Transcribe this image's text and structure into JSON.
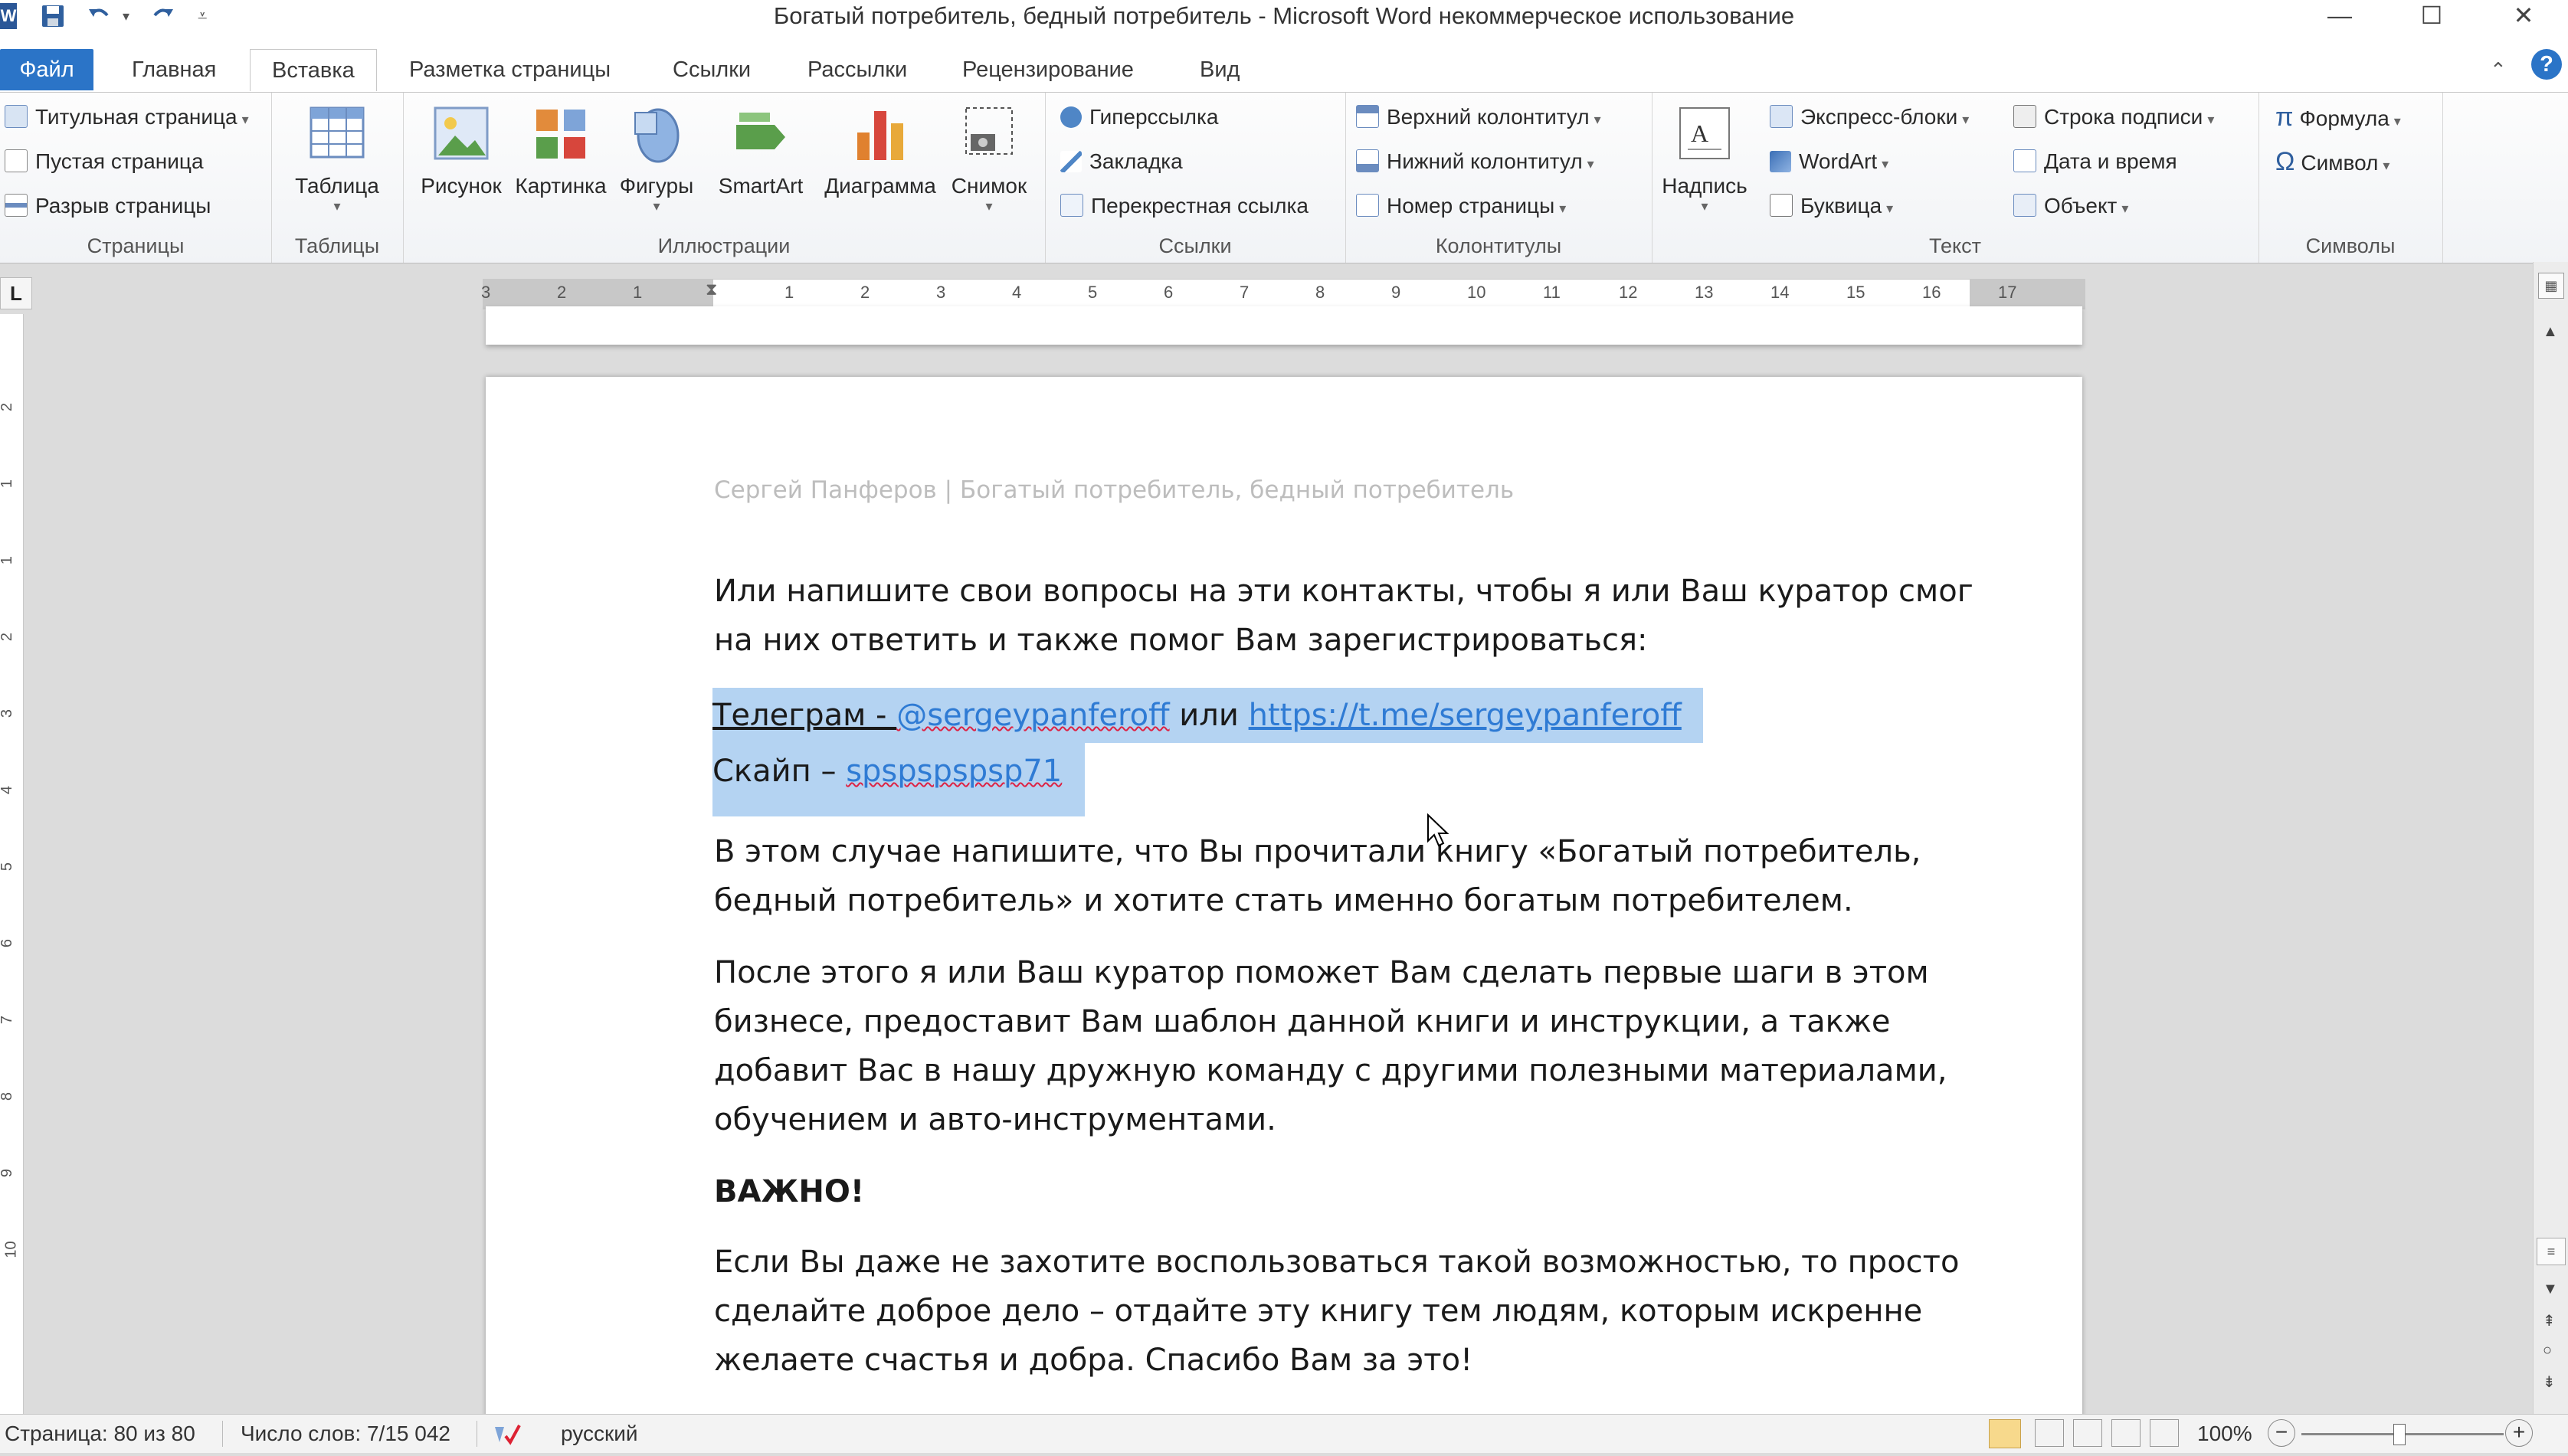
{
  "window": {
    "title": "Богатый потребитель, бедный потребитель  -  Microsoft Word некоммерческое использование",
    "minimize": "—",
    "maximize": "☐",
    "close": "✕"
  },
  "tabs": [
    "Файл",
    "Главная",
    "Вставка",
    "Разметка страницы",
    "Ссылки",
    "Рассылки",
    "Рецензирование",
    "Вид"
  ],
  "ribbon": {
    "pages": {
      "label": "Страницы",
      "items": [
        "Титульная страница",
        "Пустая страница",
        "Разрыв страницы"
      ]
    },
    "tables": {
      "label": "Таблицы",
      "table": "Таблица"
    },
    "illustrations": {
      "label": "Иллюстрации",
      "items": [
        "Рисунок",
        "Картинка",
        "Фигуры",
        "SmartArt",
        "Диаграмма",
        "Снимок"
      ]
    },
    "links": {
      "label": "Ссылки",
      "items": [
        "Гиперссылка",
        "Закладка",
        "Перекрестная ссылка"
      ]
    },
    "headers": {
      "label": "Колонтитулы",
      "items": [
        "Верхний колонтитул",
        "Нижний колонтитул",
        "Номер страницы"
      ]
    },
    "text": {
      "label": "Текст",
      "textbox": "Надпись",
      "items": [
        "Экспресс-блоки",
        "WordArt",
        "Буквица",
        "Строка подписи",
        "Дата и время",
        "Объект"
      ]
    },
    "symbols": {
      "label": "Символы",
      "items": [
        "Формула",
        "Символ"
      ]
    }
  },
  "ruler": {
    "h_left": [
      "3",
      "2",
      "1"
    ],
    "h_right": [
      "1",
      "2",
      "3",
      "4",
      "5",
      "6",
      "7",
      "8",
      "9",
      "10",
      "11",
      "12",
      "13",
      "14",
      "15",
      "16",
      "17"
    ],
    "v": [
      "2",
      "1",
      "1",
      "2",
      "3",
      "4",
      "5",
      "6",
      "7",
      "8",
      "9",
      "10"
    ]
  },
  "document": {
    "running_header": "Сергей Панферов | Богатый потребитель, бедный потребитель",
    "p1_line1": "Или напишите свои вопросы на эти контакты, чтобы я или Ваш куратор смог",
    "p1_line2": "на них ответить и также помог Вам зарегистрироваться:",
    "telegram_label": "Телеграм - ",
    "telegram_handle": "@sergeypanferoff",
    "telegram_or": " или ",
    "telegram_url": "https://t.me/sergeypanferoff",
    "skype_label": "Скайп – ",
    "skype_handle": "spspspspsp71",
    "p2_line1": "В этом случае напишите, что Вы прочитали книгу «Богатый потребитель,",
    "p2_line2": "бедный потребитель» и хотите стать именно богатым потребителем.",
    "p3_line1": "После этого я или Ваш куратор поможет Вам сделать первые шаги в этом",
    "p3_line2": "бизнесе, предоставит Вам шаблон данной книги и инструкции, а также",
    "p3_line3": "добавит Вас в нашу дружную команду с другими полезными материалами,",
    "p3_line4": "обучением и авто-инструментами.",
    "important": "ВАЖНО!",
    "p4_line1": "Если Вы даже не захотите воспользоваться такой возможностью, то просто",
    "p4_line2": "сделайте доброе дело – отдайте эту книгу тем людям, которым искренне",
    "p4_line3": "желаете счастья и добра. Спасибо Вам за это!"
  },
  "statusbar": {
    "page": "Страница: 80 из 80",
    "words": "Число слов: 7/15 042",
    "language": "русский",
    "zoom": "100%"
  }
}
